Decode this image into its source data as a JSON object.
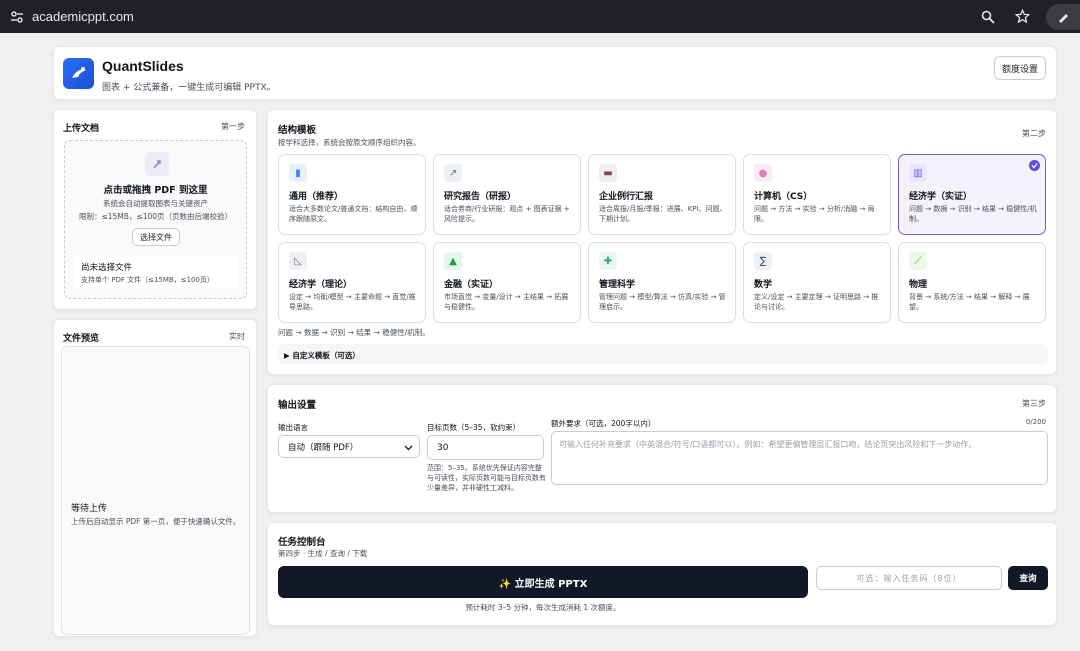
{
  "browser": {
    "url": "academicppt.com",
    "icons": [
      "tune-icon",
      "zoom-icon",
      "bookmark-star-icon",
      "extension-icon"
    ]
  },
  "header": {
    "app_title": "QuantSlides",
    "subtitle": "图表 + 公式兼备，一键生成可编辑 PPTX。",
    "quota_button": "额度设置"
  },
  "upload": {
    "title": "上传文档",
    "step": "第一步",
    "drop_title": "点击或拖拽 PDF 到这里",
    "drop_sub": "系统会自动提取图表与关键资产",
    "limit": "限制：≤15MB，≤100页（页数由后端校验）",
    "choose_button": "选择文件",
    "status_title": "尚未选择文件",
    "status_sub": "支持单个 PDF 文件（≤15MB，≤100页）"
  },
  "preview": {
    "title": "文件预览",
    "badge": "实时",
    "empty_title": "等待上传",
    "empty_sub": "上传后自动显示 PDF 第一页，便于快速确认文件。"
  },
  "templates": {
    "title": "结构模板",
    "subtitle": "按学科选择，系统会按原文顺序组织内容。",
    "step": "第二步",
    "items": [
      {
        "title": "通用（推荐）",
        "desc": "适合大多数论文/普通文档：结构自由，顺序跟随原文。",
        "icon": "book-icon",
        "icon_color": "#e6f0fd",
        "glyph": "▮",
        "glyph_color": "#3b82f6"
      },
      {
        "title": "研究报告（研报）",
        "desc": "适合券商/行业研报：观点 + 图表证据 + 风险提示。",
        "icon": "trend-chart-icon",
        "icon_color": "#eef0f6",
        "glyph": "↗",
        "glyph_color": "#5a6b8c"
      },
      {
        "title": "企业例行汇报",
        "desc": "适合周报/月报/季报：进展、KPI、问题、下期计划。",
        "icon": "briefcase-icon",
        "icon_color": "#f4ecf3",
        "glyph": "▬",
        "glyph_color": "#8a3c5d"
      },
      {
        "title": "计算机（CS）",
        "desc": "问题 → 方法 → 实验 → 分析/消融 → 局限。",
        "icon": "brain-icon",
        "icon_color": "#fbe9f3",
        "glyph": "●",
        "glyph_color": "#e07ab0"
      },
      {
        "title": "经济学（实证）",
        "desc": "问题 → 数据 → 识别 → 结果 → 稳健性/机制。",
        "icon": "bar-chart-icon",
        "icon_color": "#e7e7fb",
        "glyph": "▥",
        "glyph_color": "#6b5fe0",
        "selected": true
      },
      {
        "title": "经济学（理论）",
        "desc": "设定 → 均衡/模型 → 主要命题 → 直觉/推导思路。",
        "icon": "triangle-ruler-icon",
        "icon_color": "#eef0f4",
        "glyph": "◺",
        "glyph_color": "#6b7280"
      },
      {
        "title": "金融（实证）",
        "desc": "市场直觉 → 变量/设计 → 主结果 → 拓展与稳健性。",
        "icon": "growth-chart-icon",
        "icon_color": "#e5f5ea",
        "glyph": "▲",
        "glyph_color": "#16a34a"
      },
      {
        "title": "管理科学",
        "desc": "管理问题 → 模型/算法 → 仿真/实验 → 管理启示。",
        "icon": "puzzle-icon",
        "icon_color": "#e8f6ec",
        "glyph": "✚",
        "glyph_color": "#3aa860"
      },
      {
        "title": "数学",
        "desc": "定义/设定 → 主要定理 → 证明思路 → 推论与讨论。",
        "icon": "sigma-icon",
        "icon_color": "#eef0f6",
        "glyph": "∑",
        "glyph_color": "#3b4a6b"
      },
      {
        "title": "物理",
        "desc": "背景 → 系统/方法 → 结果 → 解释 → 展望。",
        "icon": "test-tube-icon",
        "icon_color": "#edf7e8",
        "glyph": "⟋",
        "glyph_color": "#65a30d"
      }
    ],
    "selected_chain": "问题 → 数据 → 识别 → 结果 → 稳健性/机制。",
    "custom_label": "▶  自定义模板（可选）"
  },
  "output": {
    "title": "输出设置",
    "step": "第三步",
    "lang_label": "输出语言",
    "lang_value": "自动（跟随 PDF）",
    "pages_label": "目标页数（5–35，软约束）",
    "pages_value": "30",
    "pages_hint": "范围：5–35。系统优先保证内容完整与可读性，实际页数可能与目标页数有少量差异，并非硬性工减料。",
    "extra_label": "额外要求（可选，200字以内）",
    "extra_count": "0/200",
    "extra_placeholder": "可输入任何补充要求（中英混合/符号/口语都可以）。例如：希望更偏管理层汇报口吻，结论页突出风险和下一步动作。"
  },
  "task": {
    "title": "任务控制台",
    "subtitle": "第四步 · 生成 / 查询 / 下载",
    "generate_button": "✨ 立即生成 PPTX",
    "generate_hint": "预计耗时 3–5 分钟，每次生成消耗 1 次额度。",
    "task_placeholder": "可选：输入任务码（8位）",
    "query_button": "查询"
  },
  "colors": {
    "accent": "#5b4fe0",
    "dark_button": "#111827",
    "logo": "#2a6df4"
  }
}
